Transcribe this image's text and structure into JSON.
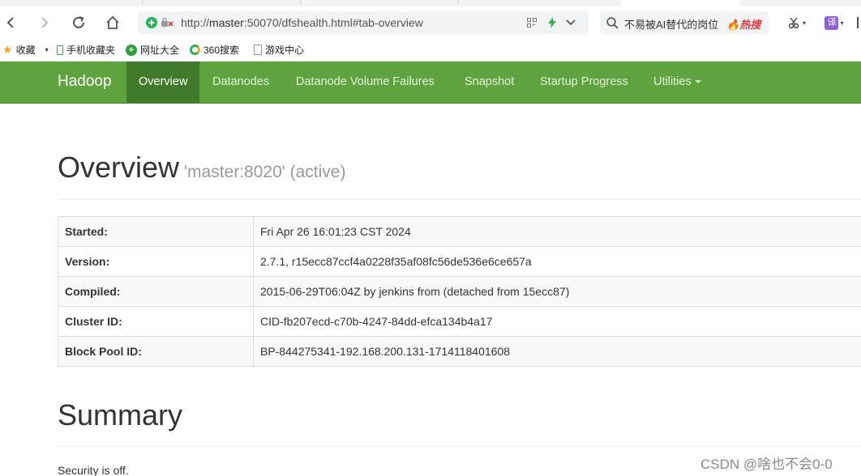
{
  "browser": {
    "url_prefix": "http://",
    "url_host": "master",
    "url_rest": ":50070/dfshealth.html#tab-overview",
    "search_query": "不易被AI替代的岗位",
    "hot_badge": "热搜",
    "translate_label": "译",
    "bookmarks": [
      "收藏",
      "手机收藏夹",
      "网址大全",
      "360搜索",
      "游戏中心"
    ]
  },
  "navbar": {
    "brand": "Hadoop",
    "items": [
      "Overview",
      "Datanodes",
      "Datanode Volume Failures",
      "Snapshot",
      "Startup Progress",
      "Utilities"
    ],
    "active_index": 0,
    "color": "#5fa33e",
    "active_color": "#417a2a"
  },
  "overview": {
    "title": "Overview",
    "subtitle": "'master:8020' (active)",
    "rows": [
      {
        "key": "Started:",
        "value": "Fri Apr 26 16:01:23 CST 2024"
      },
      {
        "key": "Version:",
        "value": "2.7.1, r15ecc87ccf4a0228f35af08fc56de536e6ce657a"
      },
      {
        "key": "Compiled:",
        "value": "2015-06-29T06:04Z by jenkins from (detached from 15ecc87)"
      },
      {
        "key": "Cluster ID:",
        "value": "CID-fb207ecd-c70b-4247-84dd-efca134b4a17"
      },
      {
        "key": "Block Pool ID:",
        "value": "BP-844275341-192.168.200.131-1714118401608"
      }
    ]
  },
  "summary": {
    "title": "Summary",
    "security_text": "Security is off."
  },
  "watermark": "CSDN @啥也不会0-0"
}
